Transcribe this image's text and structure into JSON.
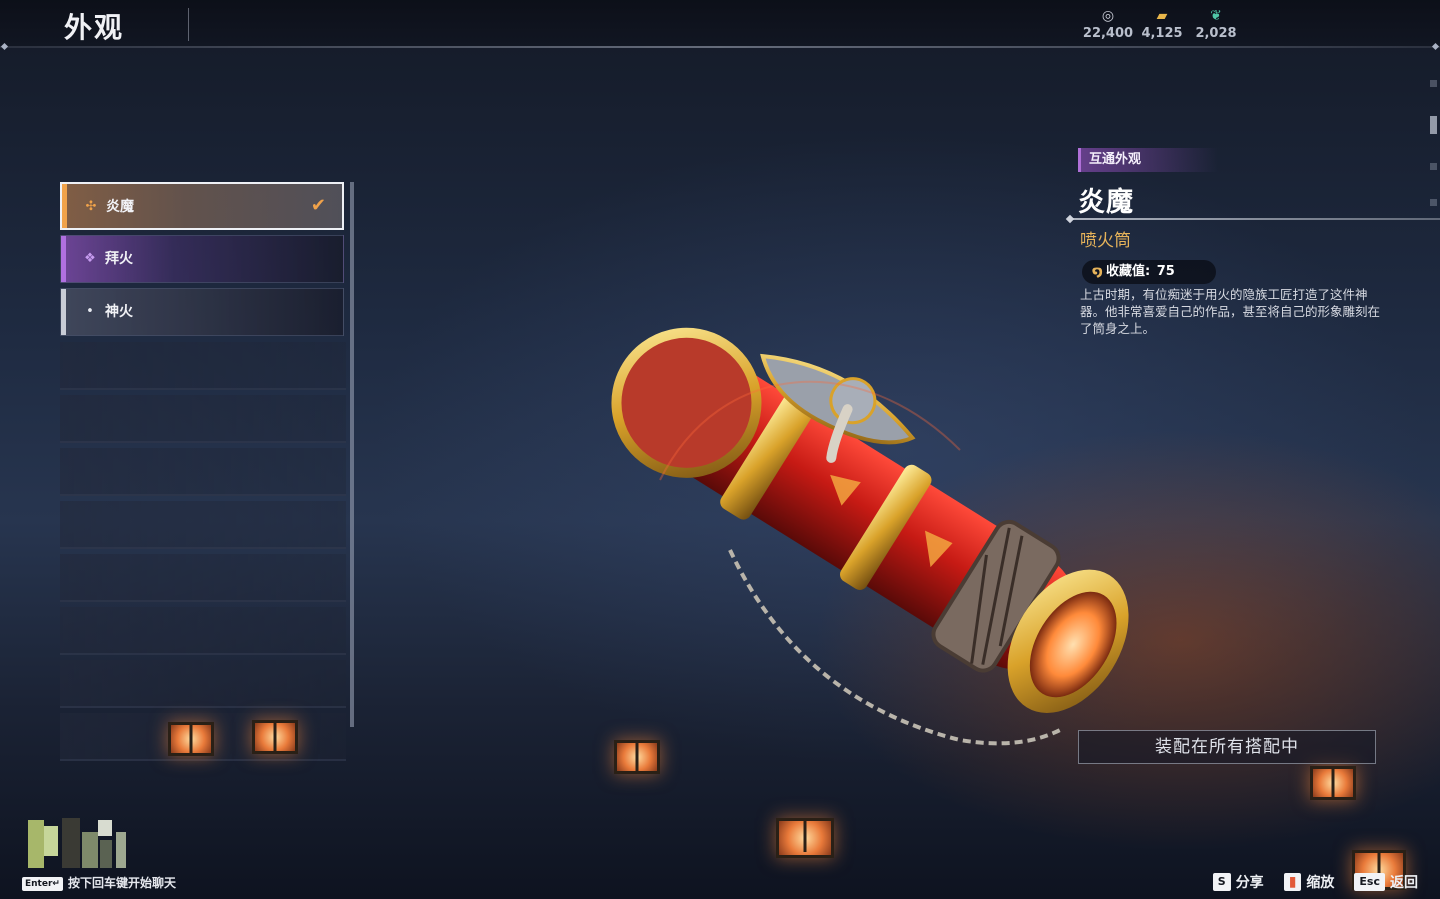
{
  "header": {
    "title": "外观",
    "currencies": [
      {
        "icon": "coin-stack-icon",
        "glyph": "◎",
        "color": "#c9ccd6",
        "value": "22,400"
      },
      {
        "icon": "gold-bar-icon",
        "glyph": "▰",
        "color": "#e8b64a",
        "value": "4,125"
      },
      {
        "icon": "jade-feather-icon",
        "glyph": "❦",
        "color": "#4fc6a6",
        "value": "2,028"
      }
    ]
  },
  "skin_list": {
    "items": [
      {
        "label": "炎魔",
        "rarity": "legendary",
        "accent": "#f0a24a",
        "icon": "legendary-rarity-icon",
        "glyph": "✣",
        "selected": true
      },
      {
        "label": "拜火",
        "rarity": "epic",
        "accent": "#b070e0",
        "icon": "epic-rarity-icon",
        "glyph": "❖",
        "selected": false
      },
      {
        "label": "神火",
        "rarity": "common",
        "accent": "#c8ccd6",
        "icon": "common-rarity-icon",
        "glyph": "•",
        "selected": false
      }
    ]
  },
  "detail": {
    "tag": "互通外观",
    "name": "炎魔",
    "type": "喷火筒",
    "collection_label": "收藏值:",
    "collection_value": "75",
    "description": "上古时期，有位痴迷于用火的隐族工匠打造了这件神器。他非常喜爱自己的作品，甚至将自己的形象雕刻在了筒身之上。"
  },
  "equip_button": "装配在所有搭配中",
  "chat": {
    "key": "Enter↵",
    "hint": "按下回车键开始聊天"
  },
  "hotkeys": [
    {
      "key": "S",
      "label": "分享"
    },
    {
      "key": "",
      "label": "缩放",
      "icon": "book-zoom-icon"
    },
    {
      "key": "Esc",
      "label": "返回"
    }
  ]
}
